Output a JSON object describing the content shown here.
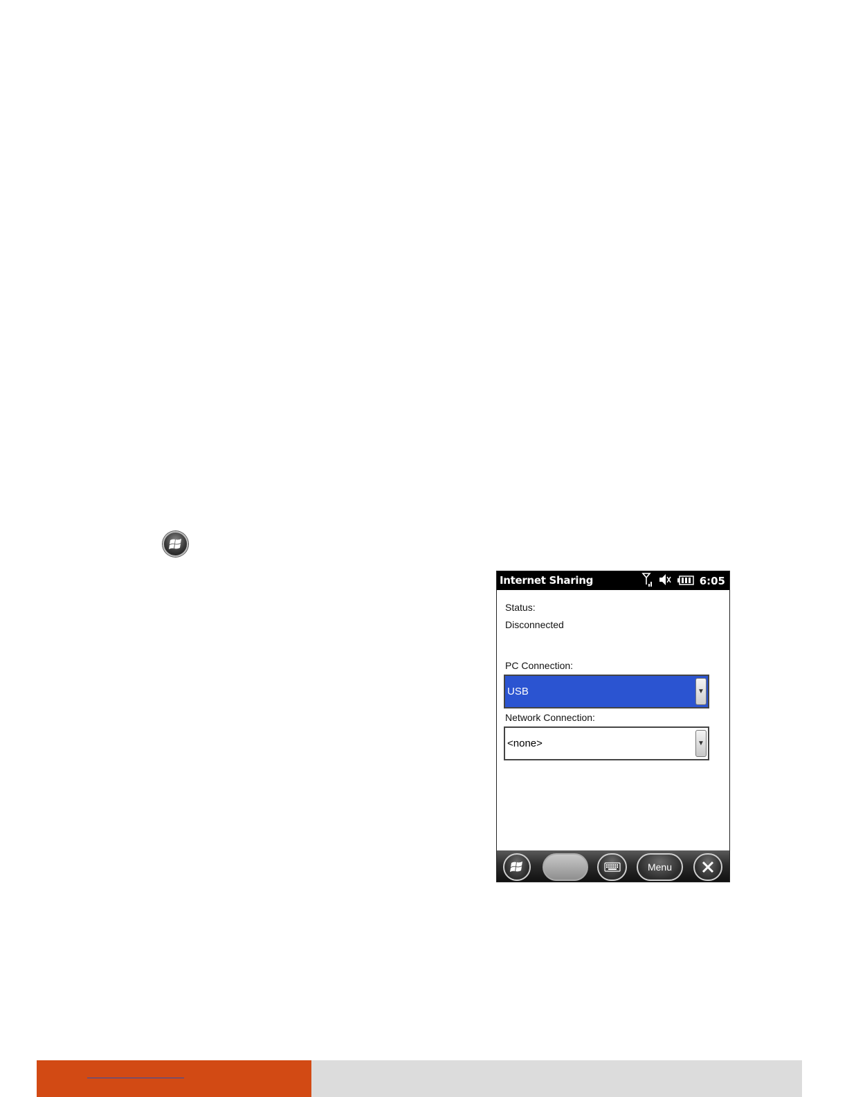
{
  "device": {
    "statusbar": {
      "title": "Internet Sharing",
      "time": "6:05",
      "icons": [
        "signal-icon",
        "speaker-muted-icon",
        "battery-icon"
      ]
    },
    "status_label": "Status:",
    "status_value": "Disconnected",
    "pc_connection": {
      "label": "PC Connection:",
      "value": "USB"
    },
    "network_connection": {
      "label": "Network Connection:",
      "value": "<none>"
    },
    "softbar": {
      "start_icon": "windows-start-icon",
      "left_softkey": "",
      "keyboard_icon": "keyboard-icon",
      "menu_label": "Menu",
      "close_icon": "close-icon"
    }
  },
  "colors": {
    "selection": "#2b54d1",
    "footer_accent": "#d24a14",
    "footer_gray": "#dcdcdc"
  }
}
